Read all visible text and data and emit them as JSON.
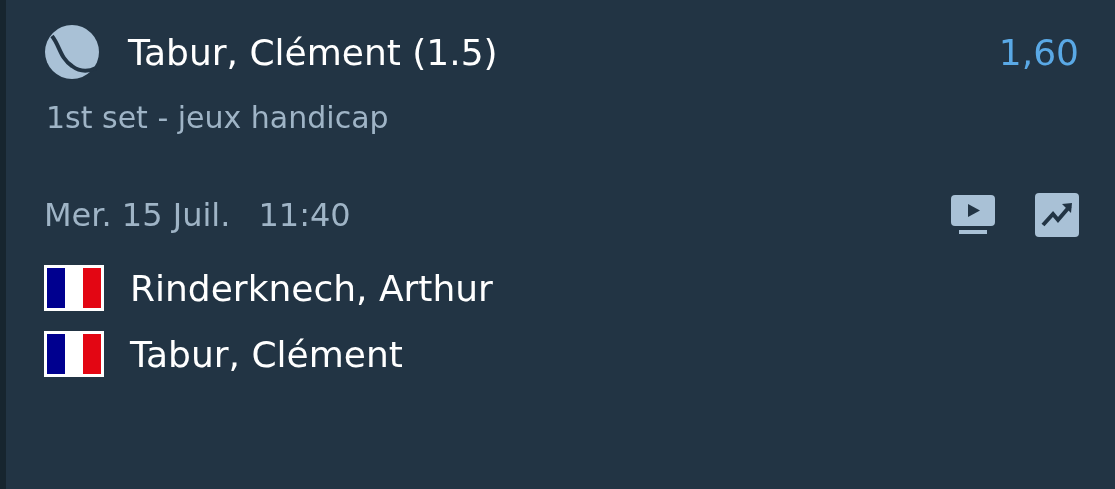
{
  "selection": {
    "name": "Tabur, Clément (1.5)",
    "odds": "1,60",
    "market": "1st set - jeux handicap"
  },
  "event": {
    "date": "Mer. 15 Juil.",
    "time": "11:40"
  },
  "players": [
    {
      "name": "Rinderknech, Arthur"
    },
    {
      "name": "Tabur, Clément"
    }
  ]
}
